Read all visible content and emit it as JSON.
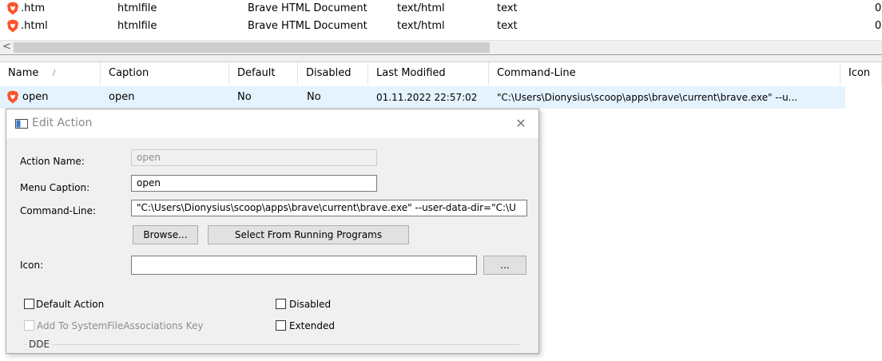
{
  "file_types": {
    "rows": [
      {
        "extension": ".htm",
        "type": "htmlfile",
        "description": "Brave HTML Document",
        "content_type": "text/html",
        "perceived": "text",
        "trailing": "0"
      },
      {
        "extension": ".html",
        "type": "htmlfile",
        "description": "Brave HTML Document",
        "content_type": "text/html",
        "perceived": "text",
        "trailing": "0"
      }
    ]
  },
  "scrollbar": {
    "left_arrow": "<"
  },
  "actions": {
    "columns": {
      "name": "Name",
      "sort_indicator": "/",
      "caption": "Caption",
      "default": "Default",
      "disabled": "Disabled",
      "last_modified": "Last Modified",
      "command_line": "Command-Line",
      "icon": "Icon"
    },
    "rows": [
      {
        "name": "open",
        "caption": "open",
        "default": "No",
        "disabled": "No",
        "last_modified": "01.11.2022 22:57:02",
        "command_line": "\"C:\\Users\\Dionysius\\scoop\\apps\\brave\\current\\brave.exe\" --u..."
      }
    ]
  },
  "dialog": {
    "title": "Edit Action",
    "close_glyph": "✕",
    "action_name_label": "Action Name:",
    "action_name_value": "open",
    "menu_caption_label": "Menu Caption:",
    "menu_caption_value": "open",
    "command_line_label": "Command-Line:",
    "command_line_value": "\"C:\\Users\\Dionysius\\scoop\\apps\\brave\\current\\brave.exe\" --user-data-dir=\"C:\\U",
    "browse_button": "Browse...",
    "select_running_button": "Select From Running Programs",
    "icon_label": "Icon:",
    "icon_value": "",
    "icon_browse_button": "...",
    "default_action_label": "Default Action",
    "disabled_label": "Disabled",
    "add_sfa_label": "Add To SystemFileAssociations Key",
    "extended_label": "Extended",
    "dde_label": "DDE"
  },
  "colors": {
    "selection": "#e5f3ff",
    "dialog_bg": "#f0f0f0",
    "brave_orange": "#fb542b"
  }
}
